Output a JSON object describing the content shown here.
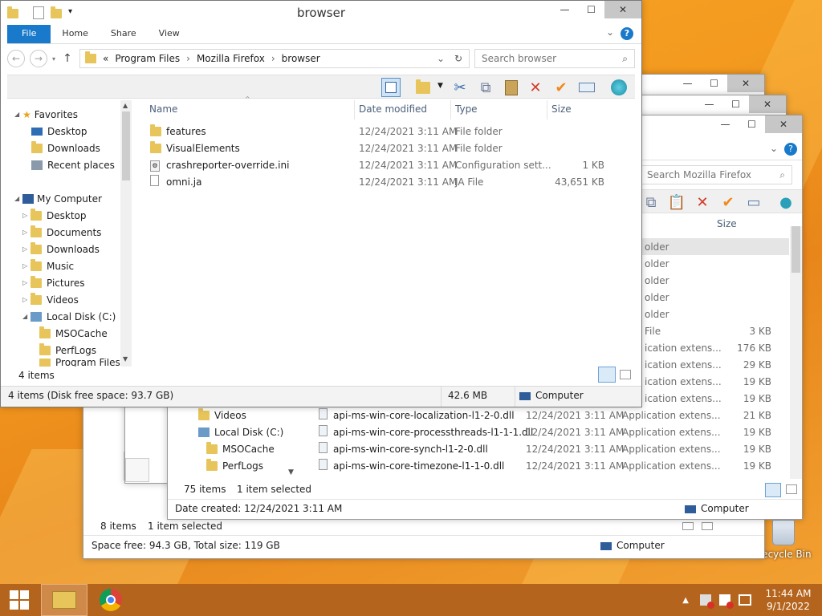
{
  "desktop": {
    "recycle_bin": "Recycle Bin"
  },
  "back_window_1": {
    "items_count": "8 items",
    "selected": "1 item selected",
    "space": "Space free: 94.3 GB, Total size: 119 GB",
    "location": "Computer"
  },
  "back_window_2": {
    "search_placeholder": "Search Mozilla Firefox",
    "col_size": "Size",
    "nav": [
      "Videos",
      "Local Disk (C:)",
      "MSOCache",
      "PerfLogs"
    ],
    "rows": [
      {
        "name": "",
        "date": "",
        "type": "older",
        "size": ""
      },
      {
        "name": "",
        "date": "",
        "type": "older",
        "size": ""
      },
      {
        "name": "",
        "date": "",
        "type": "older",
        "size": ""
      },
      {
        "name": "",
        "date": "",
        "type": "older",
        "size": ""
      },
      {
        "name": "",
        "date": "",
        "type": "older",
        "size": ""
      },
      {
        "name": "",
        "date": "",
        "type": "File",
        "size": "3 KB"
      },
      {
        "name": "",
        "date": "",
        "type": "ication extens...",
        "size": "176 KB"
      },
      {
        "name": "",
        "date": "",
        "type": "ication extens...",
        "size": "29 KB"
      },
      {
        "name": "",
        "date": "",
        "type": "ication extens...",
        "size": "19 KB"
      },
      {
        "name": "",
        "date": "",
        "type": "ication extens...",
        "size": "19 KB"
      },
      {
        "name": "api-ms-win-core-localization-l1-2-0.dll",
        "date": "12/24/2021 3:11 AM",
        "type": "Application extens...",
        "size": "21 KB"
      },
      {
        "name": "api-ms-win-core-processthreads-l1-1-1.dll",
        "date": "12/24/2021 3:11 AM",
        "type": "Application extens...",
        "size": "19 KB"
      },
      {
        "name": "api-ms-win-core-synch-l1-2-0.dll",
        "date": "12/24/2021 3:11 AM",
        "type": "Application extens...",
        "size": "19 KB"
      },
      {
        "name": "api-ms-win-core-timezone-l1-1-0.dll",
        "date": "12/24/2021 3:11 AM",
        "type": "Application extens...",
        "size": "19 KB"
      }
    ],
    "items_count": "75 items",
    "selected": "1 item selected",
    "date_created": "Date created: 12/24/2021 3:11 AM",
    "location": "Computer"
  },
  "main_window": {
    "title": "browser",
    "ribbon_tabs": [
      "File",
      "Home",
      "Share",
      "View"
    ],
    "breadcrumb": [
      "«",
      "Program Files",
      "Mozilla Firefox",
      "browser"
    ],
    "search_placeholder": "Search browser",
    "columns": {
      "name": "Name",
      "date": "Date modified",
      "type": "Type",
      "size": "Size"
    },
    "nav": {
      "favorites": "Favorites",
      "fav_items": [
        "Desktop",
        "Downloads",
        "Recent places"
      ],
      "computer": "My Computer",
      "comp_items": [
        "Desktop",
        "Documents",
        "Downloads",
        "Music",
        "Pictures",
        "Videos",
        "Local Disk (C:)"
      ],
      "disk_items": [
        "MSOCache",
        "PerfLogs",
        "Program Files"
      ]
    },
    "files": [
      {
        "name": "features",
        "date": "12/24/2021 3:11 AM",
        "type": "File folder",
        "size": "",
        "icon": "folder-icon"
      },
      {
        "name": "VisualElements",
        "date": "12/24/2021 3:11 AM",
        "type": "File folder",
        "size": "",
        "icon": "folder-icon"
      },
      {
        "name": "crashreporter-override.ini",
        "date": "12/24/2021 3:11 AM",
        "type": "Configuration sett...",
        "size": "1 KB",
        "icon": "settings-file-icon"
      },
      {
        "name": "omni.ja",
        "date": "12/24/2021 3:11 AM",
        "type": "JA File",
        "size": "43,651 KB",
        "icon": "file-icon"
      }
    ],
    "items_count": "4 items",
    "status_left": "4 items (Disk free space: 93.7 GB)",
    "status_size": "42.6 MB",
    "status_location": "Computer"
  },
  "taskbar": {
    "time": "11:44 AM",
    "date": "9/1/2022"
  },
  "colors": {
    "accent": "#1979ca",
    "taskbar": "#b4641c",
    "wallpaper": "#f39a1f"
  }
}
